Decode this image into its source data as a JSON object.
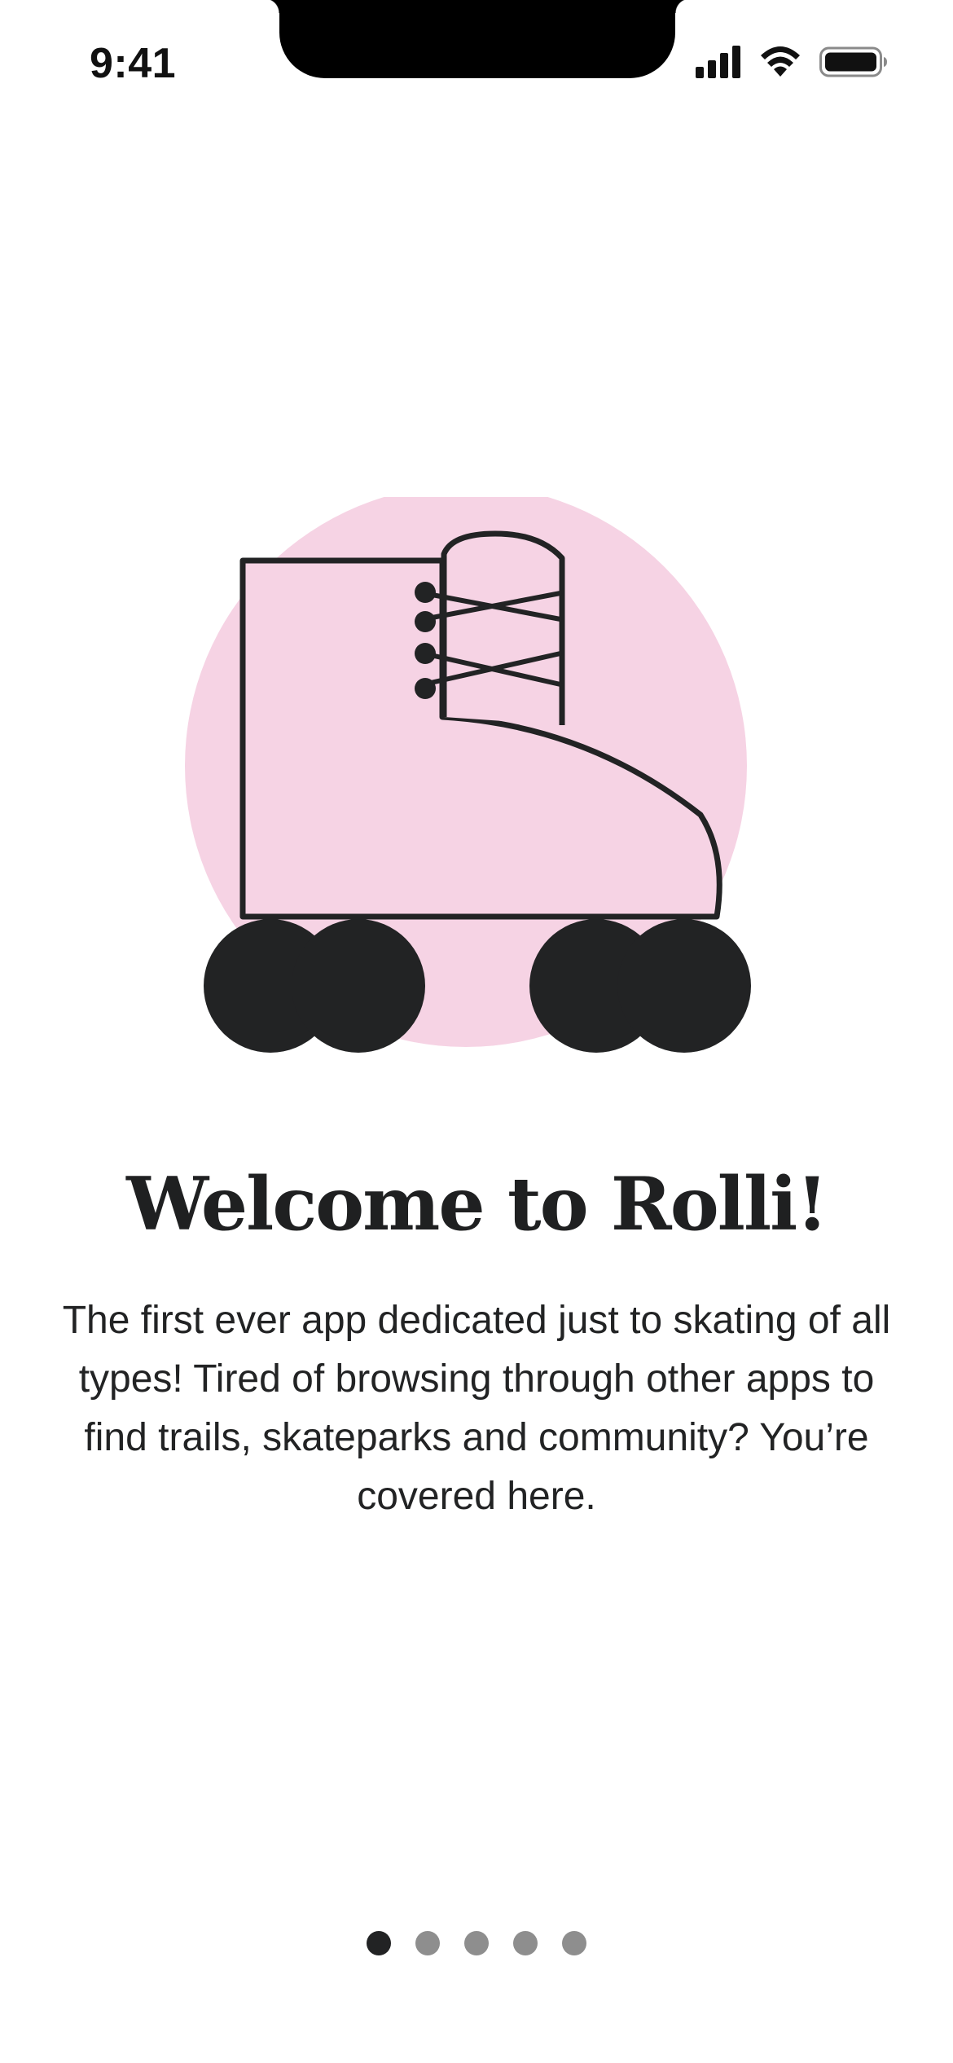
{
  "status_bar": {
    "time": "9:41",
    "icons": [
      "cellular-signal-icon",
      "wifi-icon",
      "battery-icon"
    ]
  },
  "illustration": {
    "subject": "roller-skate-icon",
    "colors": {
      "circle": "#f6d3e4",
      "skate_fill": "#f6d3e4",
      "outline": "#222324",
      "wheels": "#222324"
    }
  },
  "onboarding": {
    "title": "Welcome to Rolli!",
    "body": "The first ever app dedicated just to skating of all types! Tired of browsing through other apps to find trails, skateparks and community? You’re covered here."
  },
  "pagination": {
    "total": 5,
    "current": 1,
    "active_color": "#222324",
    "inactive_color": "#8e8e8e"
  }
}
